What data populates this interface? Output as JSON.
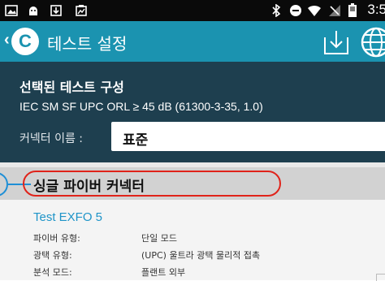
{
  "status_bar": {
    "time": "3:5",
    "icons": [
      "gallery-icon",
      "android-icon",
      "download-icon",
      "clipboard-icon",
      "bluetooth-icon",
      "do-not-disturb-icon",
      "wifi-icon",
      "no-signal-icon",
      "battery-icon"
    ]
  },
  "action_bar": {
    "logo_letter": "C",
    "title": "테스트 설정",
    "actions": [
      "download-icon",
      "globe-icon"
    ]
  },
  "config": {
    "heading": "선택된 테스트 구성",
    "value": "IEC SM SF UPC ORL ≥ 45 dB (61300-3-35, 1.0)",
    "connector_label": "커넥터 이름 :",
    "connector_value": "표준"
  },
  "section": {
    "title": "싱글 파이버 커넥터"
  },
  "item": {
    "name": "Test EXFO 5",
    "rows": [
      {
        "label": "파이버 유형:",
        "value": "단일 모드"
      },
      {
        "label": "광택 유형:",
        "value": "(UPC) 울트라 광택 물리적 접촉"
      },
      {
        "label": "분석 모드:",
        "value": "플랜트 외부"
      }
    ]
  },
  "colors": {
    "action_bar": "#1b93b0",
    "config_bg": "#1e3f4f",
    "section_bg": "#d2d2d2",
    "highlight": "#e0231a",
    "callout": "#1f8fd6",
    "link": "#1e94c8"
  }
}
